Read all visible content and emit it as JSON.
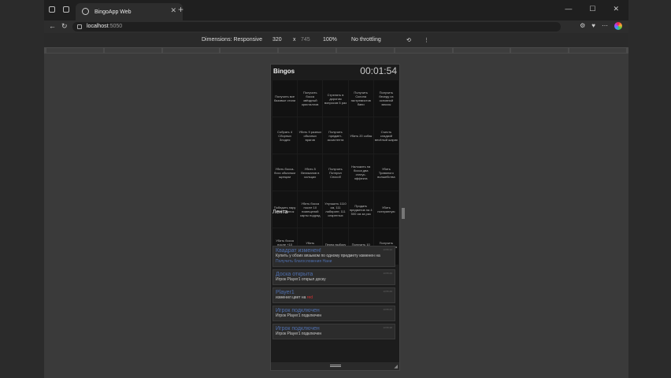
{
  "browser": {
    "tab_title": "BingoApp Web",
    "url_host": "localhost",
    "url_port": ":5050"
  },
  "devtools": {
    "dimensions_label": "Dimensions: Responsive",
    "width": "320",
    "times": "x",
    "height": "745",
    "zoom": "100%",
    "throttle": "No throttling"
  },
  "app": {
    "title": "Bingos",
    "timer": "00:01:54",
    "cells": [
      "Получить все базовые стили",
      "Получить босса звёздный кристаллов",
      "Стрелять в дорогом вопросов 5 раз",
      "Получить Склона экстремистов бани",
      "Получить беседу из основной массы",
      "Собрать 4 Сборных Злодея",
      "Убить 9 разных обычных врагов",
      "Получить предмет-ассистента",
      "Убить 20 собак",
      "Съесть сладкий весёлый шарик",
      "Убить босса-босс обычным щипцом",
      "Убить 5 Великанов в кольцах",
      "Получить Потерял Способ",
      "Наложить на босса два статус-эффекта",
      "Убить Травяного волшебства",
      "Победить пару злых Свинок",
      "Убить босса после 10 помещений карты подряд",
      "Улучшить 1110 см, 111 лабиринт, 111 секретных",
      "Продать предметов на 4 500 см за раз",
      "Убить потерянную",
      "Убить босса после +10 сделанных занятий",
      "Убить дождливого босса",
      "Перед выбору босса 10 раз",
      "Получить 10 простиле",
      "Получить благословения Нани"
    ],
    "feed_title": "Лента",
    "feed": [
      {
        "head": "Квадрат изменен!",
        "time": "13:56:12",
        "text": "Купить у обоих вязьмом по одному предмету изменен на",
        "link": "Получить благословения Нани"
      },
      {
        "head": "Доска открыта",
        "time": "13:55:49",
        "text": "Игрок Player1 открыл доску",
        "link": ""
      },
      {
        "head": "Player1",
        "time": "13:55:49",
        "text": "изменил цвет на",
        "red": "red"
      },
      {
        "head": "Игрок подключен",
        "time": "13:55:49",
        "text": "Игрок Player1 подключен",
        "link": ""
      },
      {
        "head": "Игрок подключен",
        "time": "13:55:38",
        "text": "Игрок Player1 подключен",
        "link": ""
      }
    ]
  }
}
